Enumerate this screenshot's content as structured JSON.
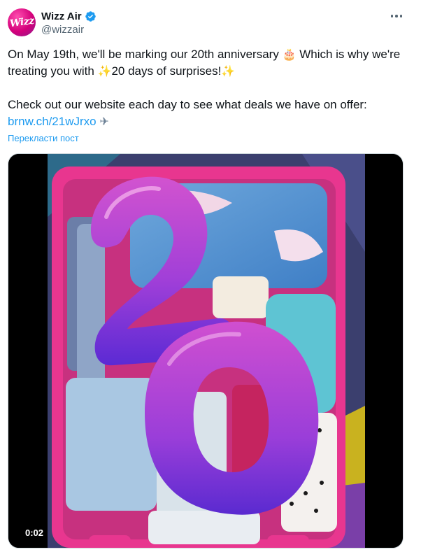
{
  "author": {
    "display_name": "Wizz Air",
    "handle": "@wizzair",
    "avatar_text": "Wizz",
    "verified": true
  },
  "tweet": {
    "line1_a": "On May 19th, we'll be marking our 20th anniversary ",
    "line1_b": " Which is why we're treating you with ",
    "line1_c": "20 days of surprises!",
    "line2": "Check out our website each day to see what deals we have on offer:",
    "link": "brnw.ch/21wJrxo",
    "emoji_cake": "🎂",
    "emoji_sparkle": "✨",
    "emoji_plane": "✈"
  },
  "translate_label": "Перекласти пост",
  "media": {
    "type": "video",
    "duration_label": "0:02"
  },
  "colors": {
    "link": "#1d9bf0",
    "secondary_text": "#536471",
    "suitcase": "#e8368f",
    "balloon_top": "#c94bd1",
    "balloon_bottom": "#6a2fd6"
  },
  "icons": {
    "more": "more-horizontal-icon",
    "verified": "verified-badge-icon"
  }
}
